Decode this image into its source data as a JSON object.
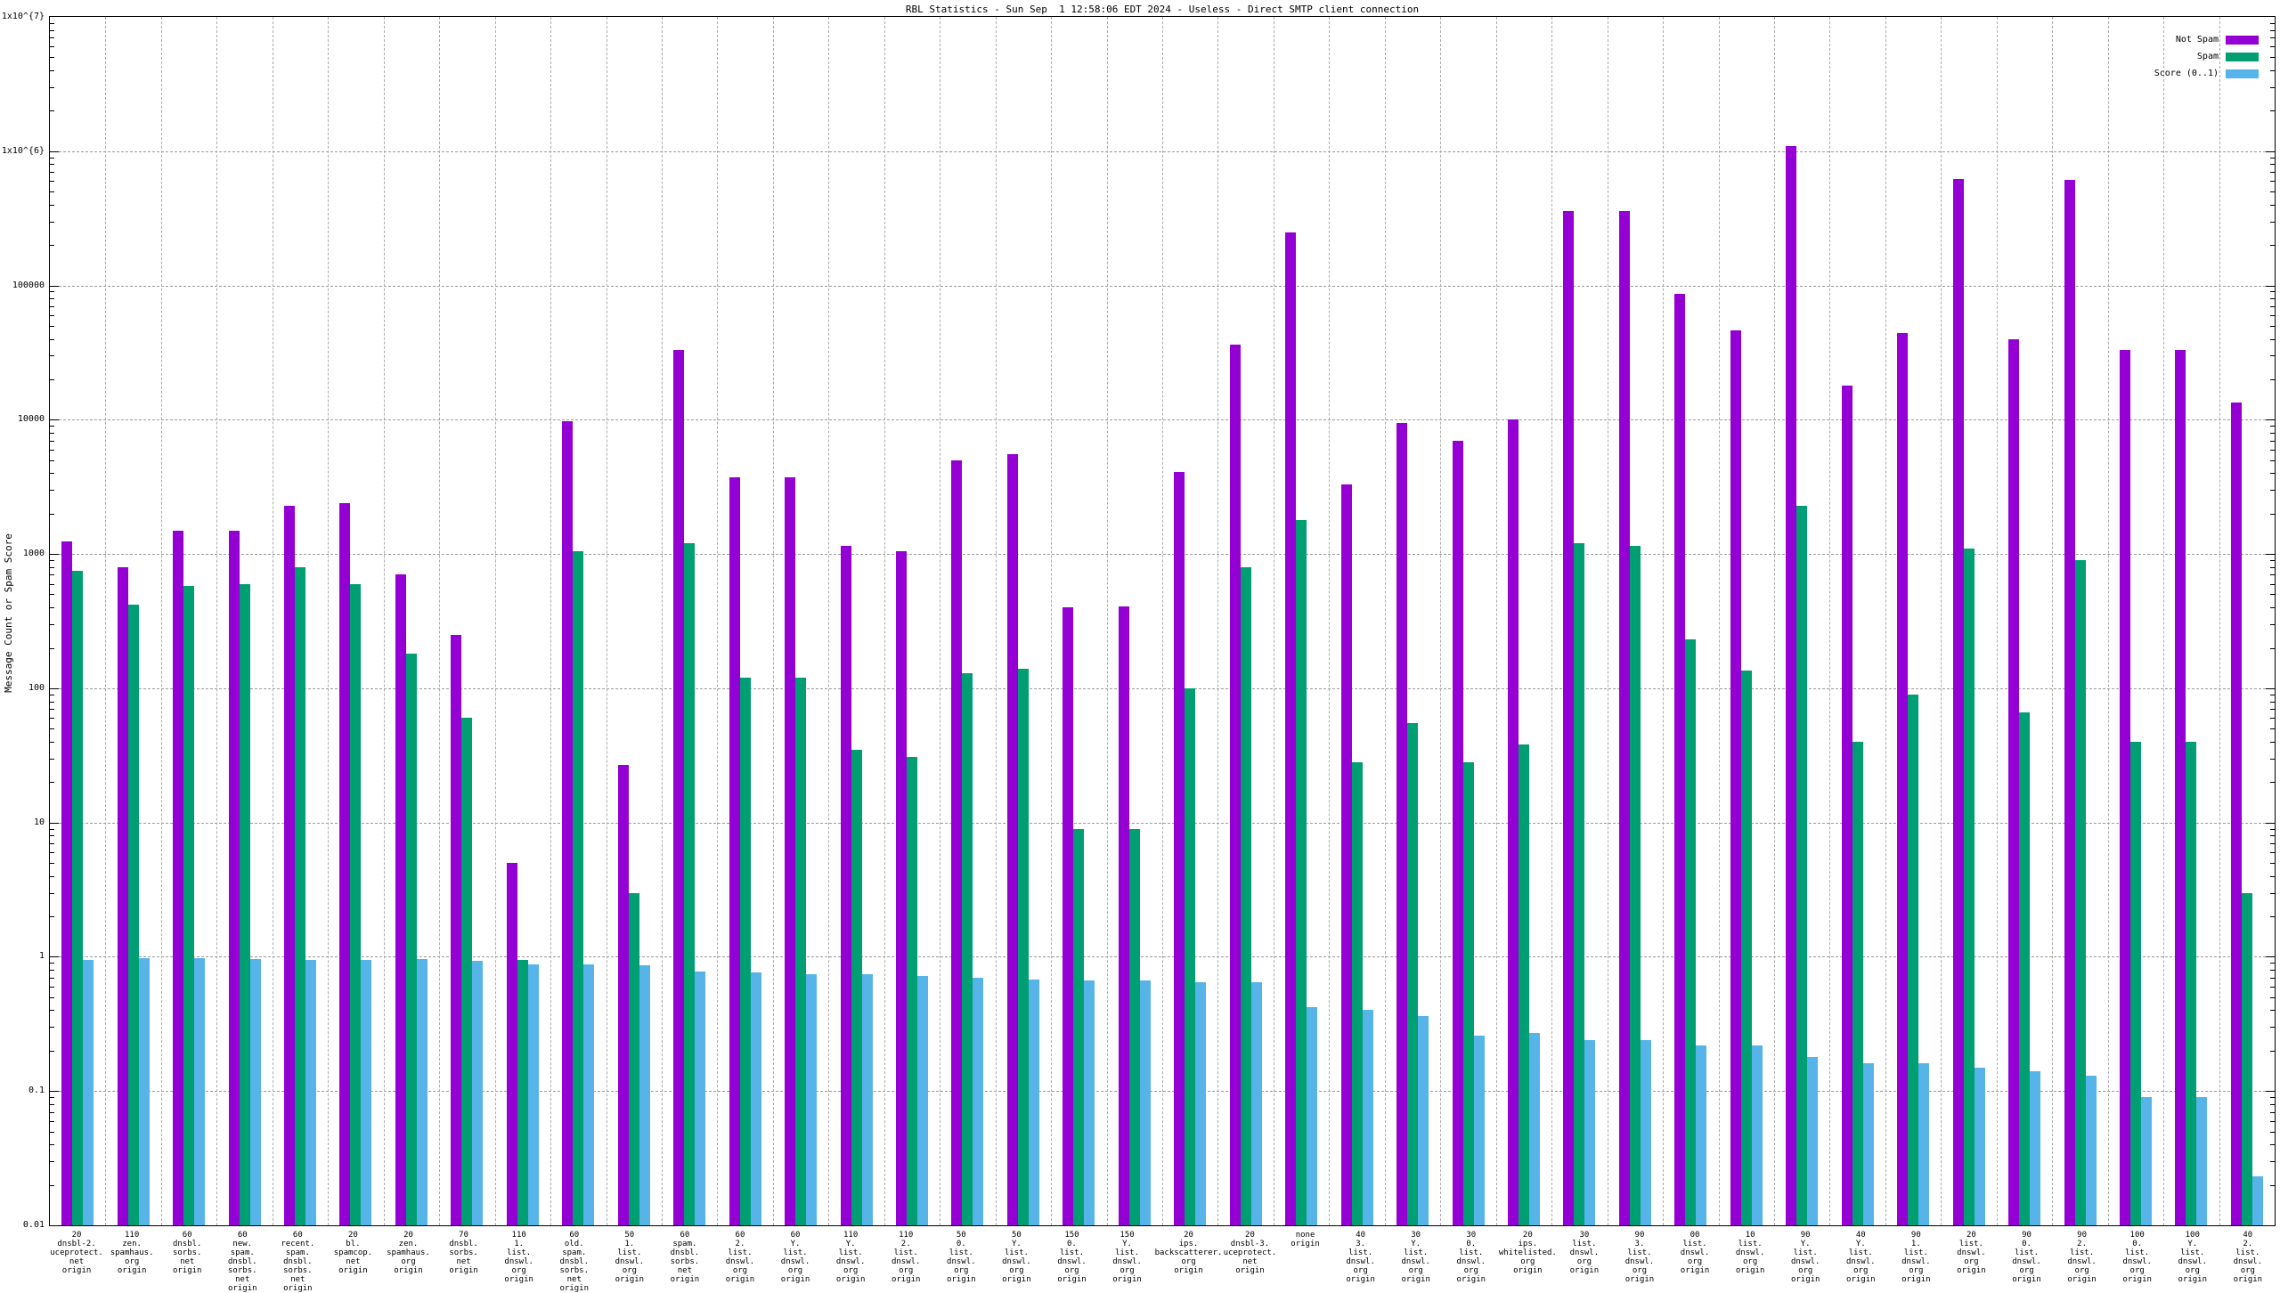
{
  "title": "RBL Statistics - Sun Sep  1 12:58:06 EDT 2024 - Useless - Direct SMTP client connection",
  "ylabel": "Message Count or Spam Score",
  "y_tick_labels": [
    "1x10^{7}",
    "1x10^{6}",
    "100000",
    "10000",
    "1000",
    "100",
    "10",
    "1",
    "0.1",
    "0.01"
  ],
  "colors": {
    "not_spam": "#9400d3",
    "spam": "#009e73",
    "score": "#56b4e9",
    "grid": "#9a9a9a",
    "axis": "#000000"
  },
  "legend": {
    "position": "top-right",
    "entries": [
      {
        "label": "Not Spam",
        "color": "#9400d3"
      },
      {
        "label": "Spam",
        "color": "#009e73"
      },
      {
        "label": "Score (0..1)",
        "color": "#56b4e9"
      }
    ]
  },
  "chart_data": {
    "type": "bar",
    "title": "RBL Statistics - Sun Sep  1 12:58:06 EDT 2024 - Useless - Direct SMTP client connection",
    "xlabel": "",
    "ylabel": "Message Count or Spam Score",
    "y_scale": "log",
    "ylim": [
      0.01,
      10000000
    ],
    "grid": true,
    "legend_position": "top-right",
    "categories": [
      "20\ndnsbl-2.\nuceprotect.\nnet\norigin",
      "110\nzen.\nspamhaus.\norg\norigin",
      "60\ndnsbl.\nsorbs.\nnet\norigin",
      "60\nnew.\nspam.\ndnsbl.\nsorbs.\nnet\norigin",
      "60\nrecent.\nspam.\ndnsbl.\nsorbs.\nnet\norigin",
      "20\nbl.\nspamcop.\nnet\norigin",
      "20\nzen.\nspamhaus.\norg\norigin",
      "70\ndnsbl.\nsorbs.\nnet\norigin",
      "110\n1.\nlist.\ndnswl.\norg\norigin",
      "60\nold.\nspam.\ndnsbl.\nsorbs.\nnet\norigin",
      "50\n1.\nlist.\ndnswl.\norg\norigin",
      "60\nspam.\ndnsbl.\nsorbs.\nnet\norigin",
      "60\n2.\nlist.\ndnswl.\norg\norigin",
      "60\nY.\nlist.\ndnswl.\norg\norigin",
      "110\nY.\nlist.\ndnswl.\norg\norigin",
      "110\n2.\nlist.\ndnswl.\norg\norigin",
      "50\n0.\nlist.\ndnswl.\norg\norigin",
      "50\nY.\nlist.\ndnswl.\norg\norigin",
      "150\n0.\nlist.\ndnswl.\norg\norigin",
      "150\nY.\nlist.\ndnswl.\norg\norigin",
      "20\nips.\nbackscatterer.\norg\norigin",
      "20\ndnsbl-3.\nuceprotect.\nnet\norigin",
      "none\norigin",
      "40\n3.\nlist.\ndnswl.\norg\norigin",
      "30\nY.\nlist.\ndnswl.\norg\norigin",
      "30\n0.\nlist.\ndnswl.\norg\norigin",
      "20\nips.\nwhitelisted.\norg\norigin",
      "30\nlist.\ndnswl.\norg\norigin",
      "90\n3.\nlist.\ndnswl.\norg\norigin",
      "00\nlist.\ndnswl.\norg\norigin",
      "10\nlist.\ndnswl.\norg\norigin",
      "90\nY.\nlist.\ndnswl.\norg\norigin",
      "40\nY.\nlist.\ndnswl.\norg\norigin",
      "90\n1.\nlist.\ndnswl.\norg\norigin",
      "20\nlist.\ndnswl.\norg\norigin",
      "90\n0.\nlist.\ndnswl.\norg\norigin",
      "90\n2.\nlist.\ndnswl.\norg\norigin",
      "100\n0.\nlist.\ndnswl.\norg\norigin",
      "100\nY.\nlist.\ndnswl.\norg\norigin",
      "40\n2.\nlist.\ndnswl.\norg\norigin"
    ],
    "series": [
      {
        "name": "Not Spam",
        "color": "#9400d3",
        "values": [
          1250,
          800,
          1500,
          1500,
          2300,
          2400,
          700,
          250,
          5,
          9800,
          27,
          33000,
          3700,
          3700,
          1150,
          1050,
          5000,
          5500,
          400,
          410,
          4100,
          36000,
          250000,
          3300,
          9500,
          7000,
          10000,
          360000,
          360000,
          87000,
          46000,
          1100000,
          18000,
          44000,
          620000,
          40000,
          610000,
          33000,
          33000,
          13500
        ]
      },
      {
        "name": "Spam",
        "color": "#009e73",
        "values": [
          750,
          420,
          580,
          600,
          800,
          600,
          180,
          60,
          0.95,
          1050,
          3,
          1200,
          120,
          120,
          35,
          31,
          130,
          140,
          9,
          9,
          100,
          800,
          1800,
          28,
          55,
          28,
          38,
          1200,
          1150,
          230,
          135,
          2300,
          40,
          90,
          1100,
          66,
          900,
          40,
          40,
          3
        ]
      },
      {
        "name": "Score (0..1)",
        "color": "#56b4e9",
        "values": [
          0.95,
          0.97,
          0.97,
          0.96,
          0.95,
          0.95,
          0.96,
          0.93,
          0.88,
          0.88,
          0.87,
          0.78,
          0.77,
          0.74,
          0.74,
          0.72,
          0.7,
          0.68,
          0.67,
          0.67,
          0.65,
          0.65,
          0.42,
          0.4,
          0.36,
          0.26,
          0.27,
          0.24,
          0.24,
          0.22,
          0.22,
          0.18,
          0.16,
          0.16,
          0.15,
          0.14,
          0.13,
          0.09,
          0.09,
          0.023
        ]
      }
    ]
  }
}
